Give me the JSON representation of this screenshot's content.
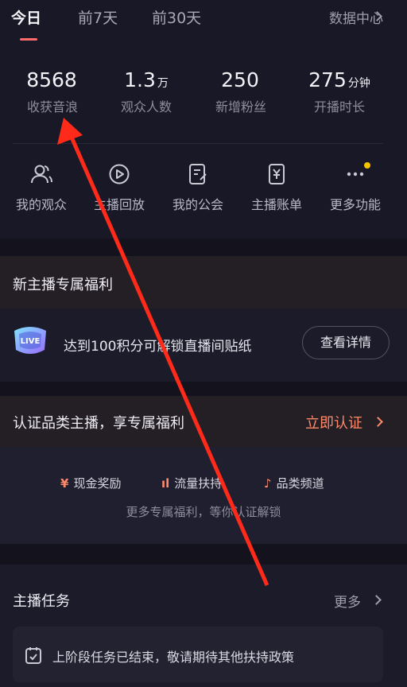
{
  "tabs": [
    "今日",
    "前7天",
    "前30天"
  ],
  "data_center": "数据中心",
  "stats": [
    {
      "value": "8568",
      "unit": "",
      "label": "收获音浪"
    },
    {
      "value": "1.3",
      "unit": "万",
      "label": "观众人数"
    },
    {
      "value": "250",
      "unit": "",
      "label": "新增粉丝"
    },
    {
      "value": "275",
      "unit": "分钟",
      "label": "开播时长"
    }
  ],
  "tools": [
    "我的观众",
    "主播回放",
    "我的公会",
    "主播账单",
    "更多功能"
  ],
  "new_anchor": {
    "title": "新主播专属福利",
    "item_text": "达到100积分可解锁直播间贴纸",
    "detail_button": "查看详情",
    "badge_text": "LIVE"
  },
  "certify": {
    "title": "认证品类主播，享专属福利",
    "action": "立即认证",
    "benefits": [
      "现金奖励",
      "流量扶持",
      "品类频道"
    ],
    "note": "更多专属福利，等你认证解锁"
  },
  "tasks": {
    "title": "主播任务",
    "more": "更多",
    "notice": "上阶段任务已结束，敬请期待其他扶持政策"
  },
  "colors": {
    "accent": "#ff6b6b",
    "dot": "#f5c400",
    "arrow": "#ff2a1a"
  }
}
